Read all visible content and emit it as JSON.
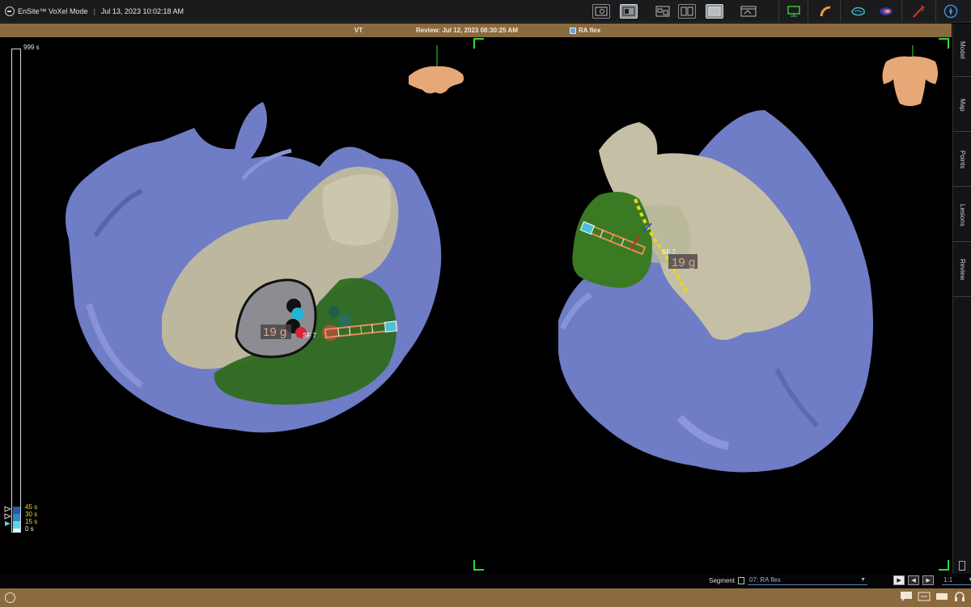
{
  "app": {
    "brand": "EnSite™ VoXel Mode",
    "separator": "|",
    "timestamp": "Jul 13, 2023 10:02:18 AM"
  },
  "toolbar": {
    "group1": [
      "zoom-view-icon",
      "split-view-icon",
      "window-icon"
    ],
    "group2": [
      "dual-view-icon",
      "fill-view-icon",
      "layout-icon"
    ],
    "group3": [
      "monitor-icon",
      "catheter-icon",
      "geometry-icon",
      "map-icon",
      "ablation-icon",
      "compass-icon"
    ]
  },
  "header": {
    "mode": "VT",
    "review": "Review: Jul 12, 2023 08:30:25 AM",
    "segment": "RA flex"
  },
  "rail": {
    "tabs": [
      "Model",
      "Map",
      "Points",
      "Lesions",
      "Review"
    ]
  },
  "timescale": {
    "top": "999 s",
    "marks": [
      "45 s",
      "30 s",
      "15 s",
      "0 s"
    ]
  },
  "left_view": {
    "force_label": "19 g",
    "catheter_label": "SF 7"
  },
  "right_view": {
    "force_label": "19 g",
    "catheter_label": "SF 7"
  },
  "segment_control": {
    "label": "Segment",
    "value": "07: RA flex",
    "ratio": "1:1",
    "buttons": [
      "play",
      "step-back",
      "step-forward"
    ]
  },
  "colors": {
    "header_brown": "#8a6a3e",
    "chamber_blue": "#7480c8",
    "chamber_beige": "#bdb7a0",
    "region_green": "#2f6b1e",
    "accent_yellow": "#f0d64a",
    "orient_green": "#2ddc3c"
  }
}
